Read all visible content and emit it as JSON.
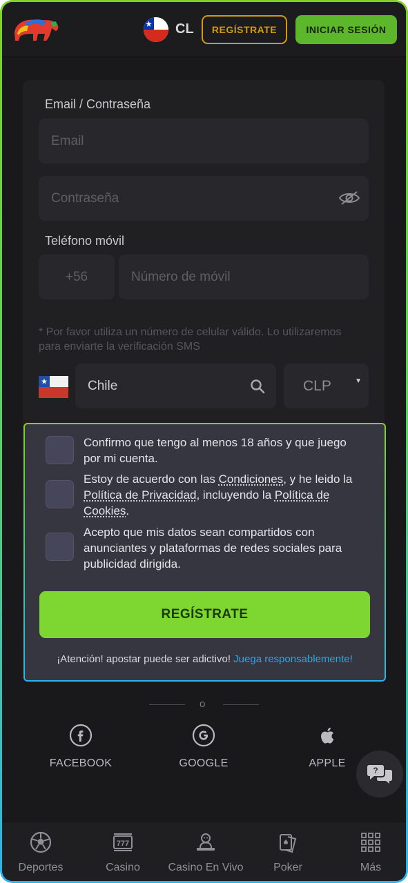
{
  "header": {
    "country_code": "CL",
    "register_label": "REGÍSTRATE",
    "login_label": "INICIAR SESIÓN"
  },
  "form": {
    "email_password_label": "Email / Contraseña",
    "email_placeholder": "Email",
    "password_placeholder": "Contraseña",
    "phone_label": "Teléfono móvil",
    "phone_prefix": "+56",
    "phone_placeholder": "Número de móvil",
    "phone_helper": "* Por favor utiliza un número de celular válido. Lo utilizaremos para enviarte la verificación SMS",
    "country_value": "Chile",
    "currency_value": "CLP"
  },
  "consent": {
    "age_text": "Confirmo que tengo al menos 18 años y que juego por mi cuenta.",
    "terms_prefix": "Estoy de acuerdo con las ",
    "terms_link": "Condiciones",
    "terms_middle": ", y he leido la ",
    "privacy_link": "Política de Privacidad",
    "terms_middle2": ", incluyendo la ",
    "cookies_link": "Política de Cookies",
    "terms_suffix": ".",
    "data_share_text": "Acepto que mis datos sean compartidos con anunciantes y plataformas de redes sociales para publicidad dirigida.",
    "register_button": "REGÍSTRATE",
    "warning_text": "¡Atención! apostar puede ser adictivo! ",
    "responsible_link": "Juega responsablemente!"
  },
  "social": {
    "divider_text": "o",
    "facebook_label": "FACEBOOK",
    "google_label": "GOOGLE",
    "apple_label": "APPLE"
  },
  "bottom_nav": [
    {
      "label": "Deportes",
      "icon": "soccer-ball-icon"
    },
    {
      "label": "Casino",
      "icon": "slot-machine-icon"
    },
    {
      "label": "Casino En Vivo",
      "icon": "live-dealer-icon"
    },
    {
      "label": "Poker",
      "icon": "playing-cards-icon"
    },
    {
      "label": "Más",
      "icon": "grid-menu-icon"
    }
  ],
  "colors": {
    "accent_green": "#7ed631",
    "register_gold": "#d29b12",
    "link_blue": "#29a9e6",
    "background": "#19191b"
  }
}
